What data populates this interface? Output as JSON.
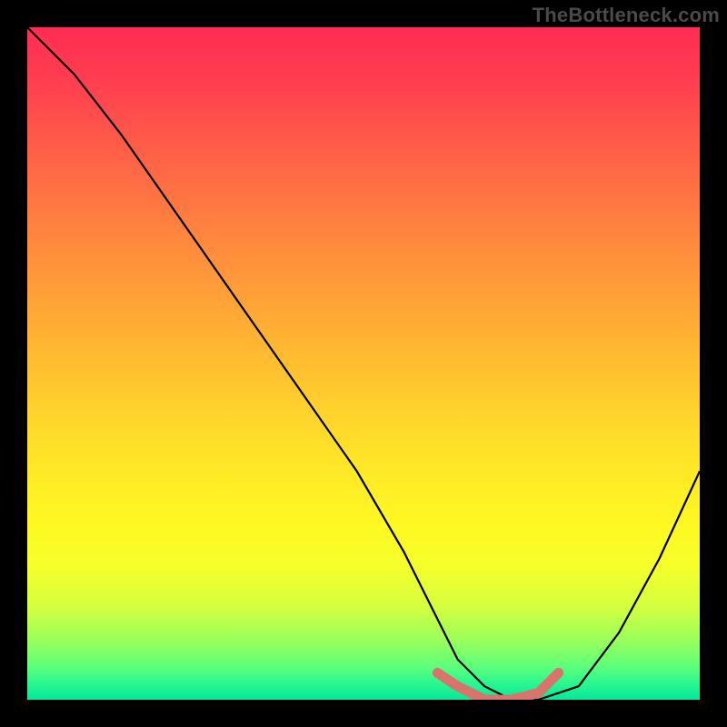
{
  "watermark": "TheBottleneck.com",
  "chart_data": {
    "type": "line",
    "title": "",
    "xlabel": "",
    "ylabel": "",
    "xlim": [
      0,
      100
    ],
    "ylim": [
      0,
      100
    ],
    "grid": false,
    "series": [
      {
        "name": "bottleneck-curve",
        "x": [
          0,
          7,
          14,
          21,
          28,
          35,
          42,
          49,
          56,
          61,
          64,
          68,
          72,
          76,
          82,
          88,
          94,
          100
        ],
        "values": [
          100,
          93,
          84,
          74,
          64,
          54,
          44,
          34,
          22,
          12,
          6,
          2,
          0,
          0,
          2,
          10,
          21,
          34
        ],
        "color": "#000000"
      },
      {
        "name": "highlight-segment",
        "x": [
          61,
          64,
          68,
          72,
          76,
          79
        ],
        "values": [
          4,
          2,
          0,
          0,
          1,
          4
        ],
        "color": "#d9746c"
      }
    ],
    "gradient_stops": [
      {
        "pos": 0,
        "color": "#ff2c52"
      },
      {
        "pos": 50,
        "color": "#ffd22c"
      },
      {
        "pos": 80,
        "color": "#f6ff2a"
      },
      {
        "pos": 100,
        "color": "#08e79a"
      }
    ]
  }
}
